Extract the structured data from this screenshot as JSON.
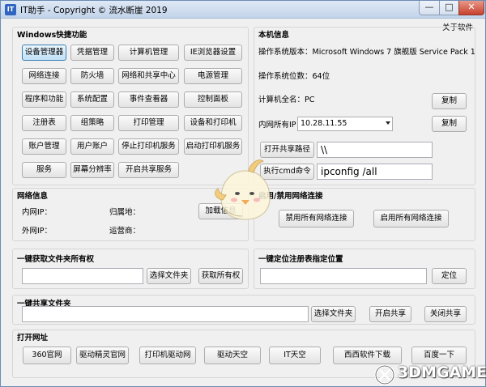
{
  "window": {
    "title": "IT助手 - Copyright © 流水断崖 2019",
    "app_icon_text": "IT",
    "min_glyph": "—",
    "max_glyph": "□",
    "close_glyph": "✕",
    "about": "关于软件"
  },
  "shortcuts": {
    "heading": "Windows快捷功能",
    "rows": [
      [
        "设备管理器",
        "凭据管理",
        "计算机管理",
        "IE浏览器设置"
      ],
      [
        "网络连接",
        "防火墙",
        "网络和共享中心",
        "电源管理"
      ],
      [
        "程序和功能",
        "系统配置",
        "事件查看器",
        "控制面板"
      ],
      [
        "注册表",
        "组策略",
        "打印管理",
        "设备和打印机"
      ],
      [
        "账户管理",
        "用户账户",
        "停止打印机服务",
        "启动打印机服务"
      ],
      [
        "服务",
        "屏幕分辨率",
        "开启共享服务"
      ]
    ]
  },
  "sysinfo": {
    "heading": "本机信息",
    "os_version": "操作系统版本：Microsoft Windows 7 旗舰版  Service Pack 1",
    "os_bits": "操作系统位数：64位",
    "computer_name": "计算机全名：PC",
    "copy1": "复制",
    "lan_ip_label": "内网所有IP：",
    "lan_ip_value": "10.28.11.55",
    "copy2": "复制",
    "open_share_btn": "打开共享路径",
    "share_path": "\\\\",
    "run_cmd_btn": "执行cmd命令",
    "cmd_value": "ipconfig /all"
  },
  "netinfo": {
    "heading": "网络信息",
    "lan_ip": "内网IP：",
    "location": "归属地：",
    "wan_ip": "外网IP：",
    "isp": "运营商：",
    "load_btn": "加载信息"
  },
  "netswitch": {
    "heading": "启用/禁用网络连接",
    "disable_all": "禁用所有网络连接",
    "enable_all": "启用所有网络连接"
  },
  "ownership": {
    "heading": "一键获取文件夹所有权",
    "choose_folder": "选择文件夹",
    "get_ownership": "获取所有权"
  },
  "regjump": {
    "heading": "一键定位注册表指定位置",
    "locate": "定位"
  },
  "share": {
    "heading": "一键共享文件夹",
    "choose_folder": "选择文件夹",
    "start_share": "开启共享",
    "stop_share": "关闭共享"
  },
  "urls": {
    "heading": "打开网址",
    "links": [
      "360官网",
      "驱动精灵官网",
      "打印机驱动网",
      "驱动天空",
      "IT天空",
      "西西软件下载",
      "百度一下"
    ]
  },
  "watermark": "3DMGAME"
}
